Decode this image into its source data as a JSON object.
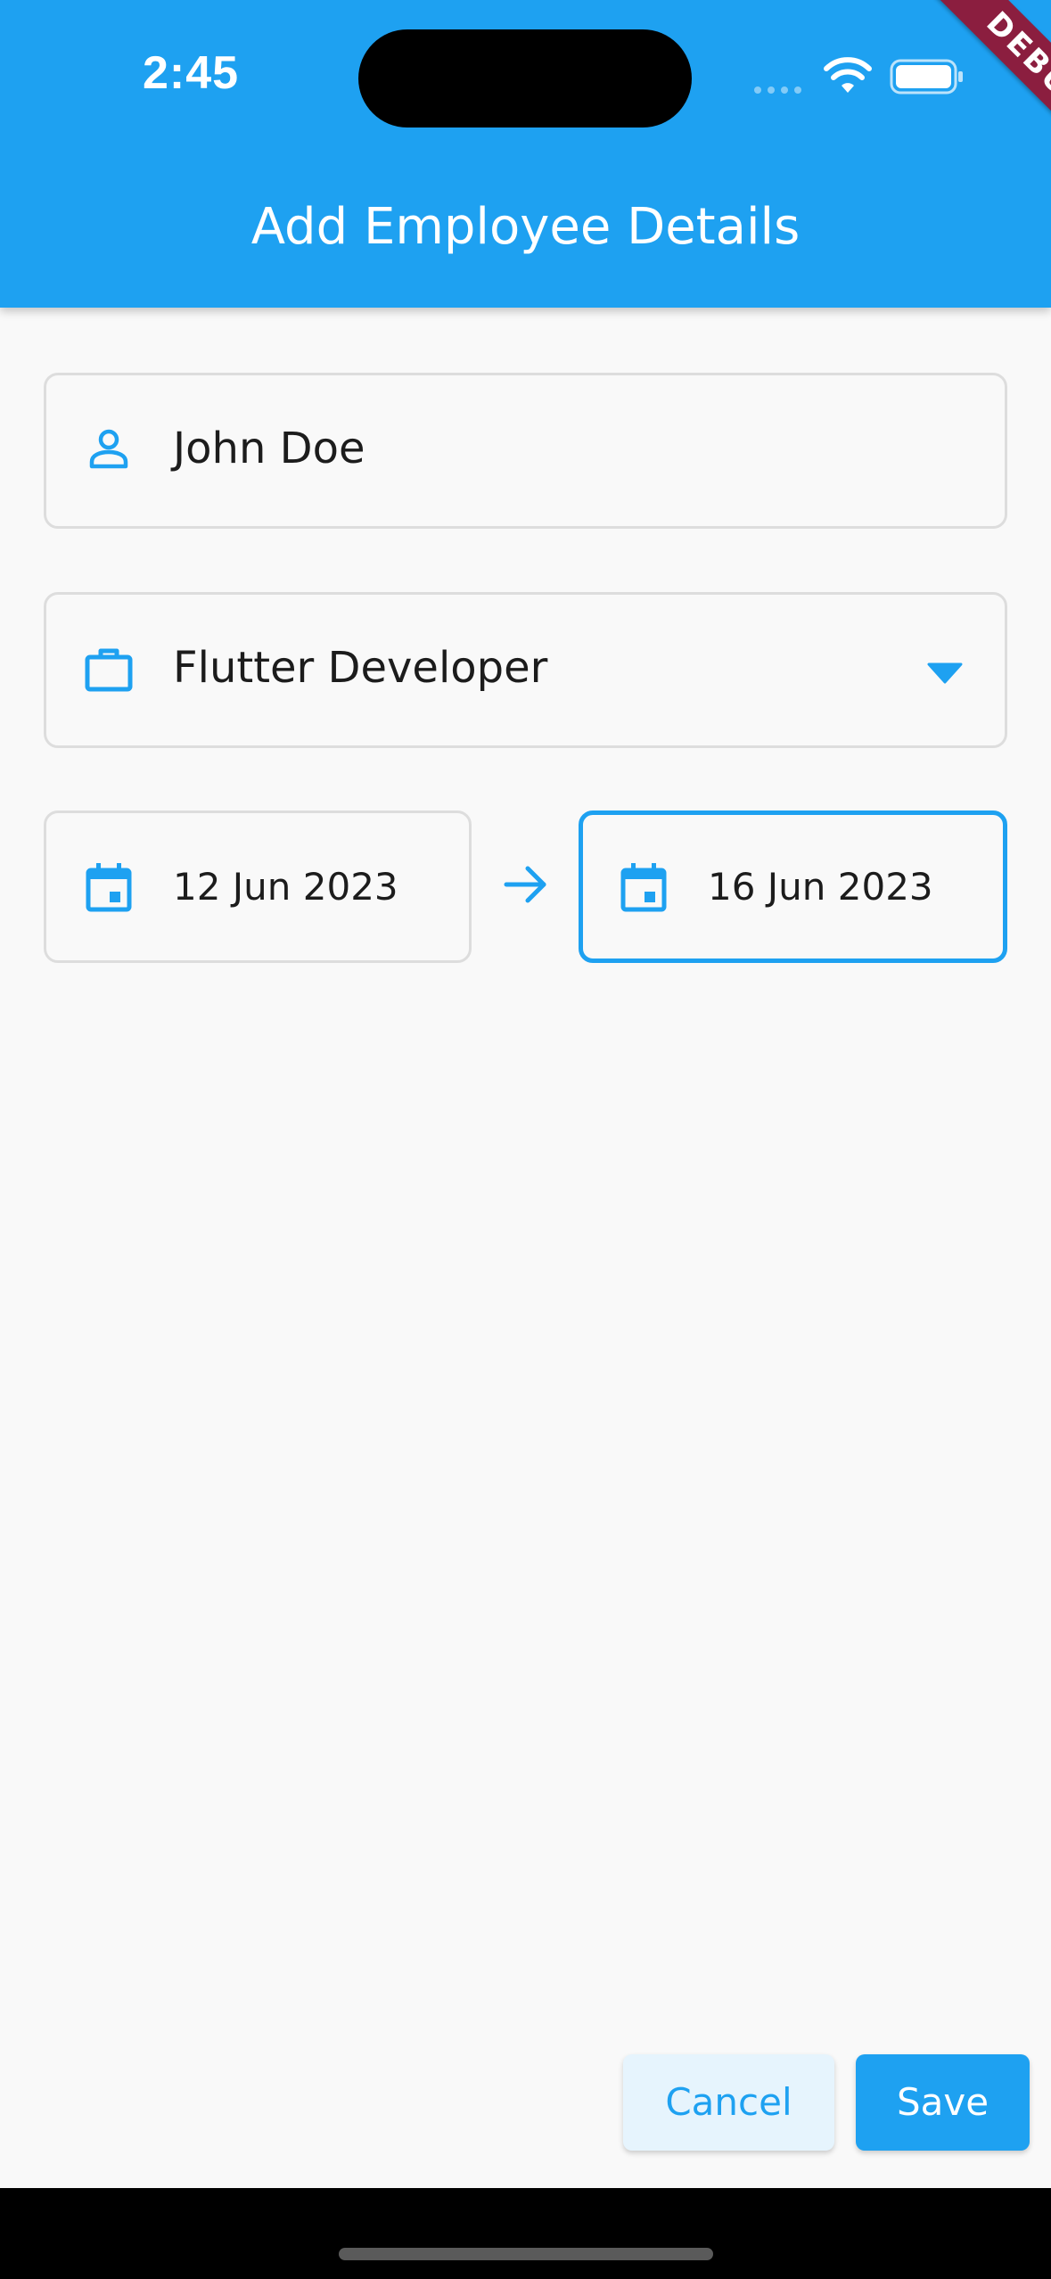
{
  "status_bar": {
    "time": "2:45"
  },
  "debug_banner": {
    "label": "DEBUG"
  },
  "app_bar": {
    "title": "Add Employee Details"
  },
  "form": {
    "name": {
      "value": "John Doe",
      "icon": "person-outline-icon"
    },
    "role": {
      "selected": "Flutter Developer",
      "icon": "briefcase-icon",
      "dropdown_icon": "dropdown-arrow-icon"
    },
    "start_date": {
      "value": "12 Jun 2023",
      "icon": "calendar-icon"
    },
    "end_date": {
      "value": "16 Jun 2023",
      "icon": "calendar-icon",
      "focused": true
    },
    "range_arrow_icon": "arrow-right-icon"
  },
  "actions": {
    "cancel_label": "Cancel",
    "save_label": "Save"
  },
  "colors": {
    "primary": "#1ea1f1",
    "background": "#f9f9f9",
    "field_border": "#dddddd",
    "debug_ribbon": "#8b1e3f",
    "cancel_bg": "#e6f4fd"
  }
}
